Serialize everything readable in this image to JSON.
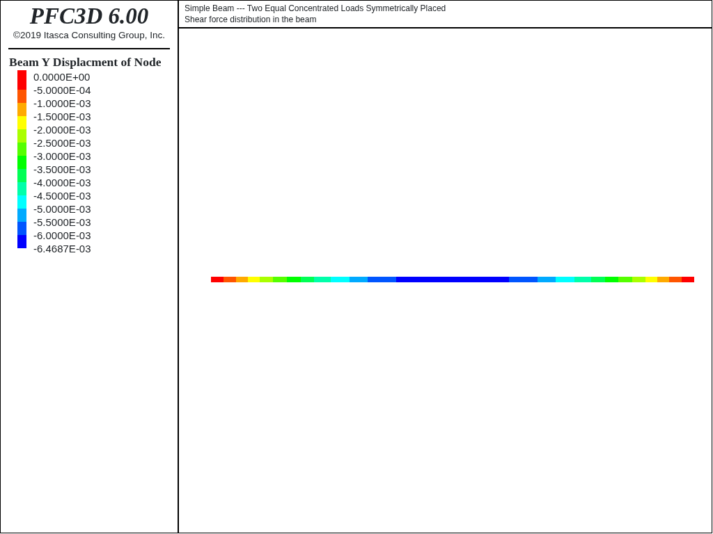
{
  "sidebar": {
    "title": "PFC3D 6.00",
    "copyright": "©2019 Itasca Consulting Group, Inc.",
    "legend": {
      "title": "Beam Y Displacment of Node",
      "bands": [
        {
          "color": "#ff0000"
        },
        {
          "color": "#ff5500"
        },
        {
          "color": "#ffaa00"
        },
        {
          "color": "#ffff00"
        },
        {
          "color": "#aaff00"
        },
        {
          "color": "#55ff00"
        },
        {
          "color": "#00ff00"
        },
        {
          "color": "#00ff55"
        },
        {
          "color": "#00ffaa"
        },
        {
          "color": "#00ffff"
        },
        {
          "color": "#00aaff"
        },
        {
          "color": "#0055ff"
        },
        {
          "color": "#0000ff"
        }
      ],
      "labels": [
        "0.0000E+00",
        "-5.0000E-04",
        "-1.0000E-03",
        "-1.5000E-03",
        "-2.0000E-03",
        "-2.5000E-03",
        "-3.0000E-03",
        "-3.5000E-03",
        "-4.0000E-03",
        "-4.5000E-03",
        "-5.0000E-03",
        "-5.5000E-03",
        "-6.0000E-03",
        "-6.4687E-03"
      ]
    }
  },
  "plot": {
    "title_lines": [
      "Simple Beam --- Two Equal Concentrated Loads Symmetrically Placed",
      "Shear force distribution in the beam"
    ]
  }
}
